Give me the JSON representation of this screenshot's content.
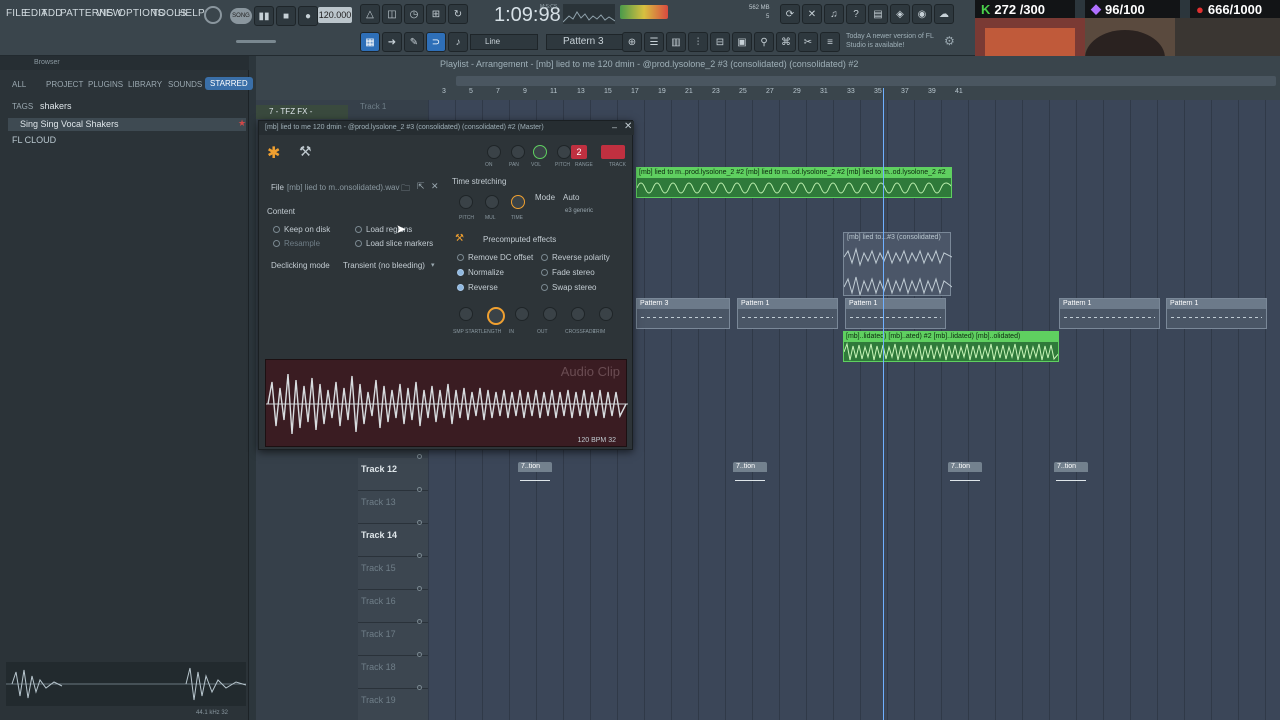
{
  "menu": [
    "FILE",
    "EDIT",
    "ADD",
    "PATTERNS",
    "VIEW",
    "OPTIONS",
    "TOOLS",
    "HELP"
  ],
  "transport": {
    "song_mode": "SONG",
    "tempo": "120.000",
    "time": "1:09:98",
    "time_unit": "M:S:CS",
    "memory": "562 MB",
    "cpu_value": "5",
    "snap": "Line",
    "pattern": "Pattern 3",
    "hint": "Today  A newer version of FL Studio is available!"
  },
  "overlay": {
    "counter1": "272 /300",
    "counter2": "96/100",
    "counter3": "666/1000"
  },
  "browser": {
    "title": "Browser",
    "tabs": [
      "ALL",
      "PROJECT",
      "PLUGINS",
      "LIBRARY",
      "SOUNDS",
      "STARRED"
    ],
    "tags_label": "TAGS",
    "search": "shakers",
    "items": [
      "Sing Sing Vocal Shakers",
      "FL CLOUD"
    ],
    "footer": "44.1 kHz 32"
  },
  "playlist": {
    "title": "Playlist - Arrangement - [mb] lied to me 120 dmin - @prod.lysolone_2 #3 (consolidated) (consolidated) #2",
    "ruler": [
      "3",
      "5",
      "7",
      "9",
      "11",
      "13",
      "15",
      "17",
      "19",
      "21",
      "23",
      "25",
      "27",
      "29",
      "31",
      "33",
      "35",
      "37",
      "39",
      "41"
    ],
    "tracks": [
      {
        "name": "Track 12",
        "on": true
      },
      {
        "name": "Track 13",
        "on": false
      },
      {
        "name": "Track 14",
        "on": true
      },
      {
        "name": "Track 15",
        "on": false
      },
      {
        "name": "Track 16",
        "on": false
      },
      {
        "name": "Track 17",
        "on": false
      },
      {
        "name": "Track 18",
        "on": false
      },
      {
        "name": "Track 19",
        "on": false
      }
    ],
    "track1_label": "Track 1",
    "clip_green_top": "[mb] lied to m..prod.lysolone_2 #2  [mb] lied to m..od.lysolone_2 #2  [mb] lied to m..od.lysolone_2 #2",
    "clip_consolidated": "[mb] lied to...#3 (consolidated)",
    "clip_green_mid": "[mb]..lidated)  [mb]..ated) #2  [mb]..lidated)  [mb]..olidated)",
    "pattern_labels": [
      "Pattern 3",
      "Pattern 1",
      "Pattern 1",
      "Pattern 1",
      "Pattern 1"
    ],
    "auto_label": "7..tion"
  },
  "channel": {
    "tab": "7 - TFZ FX - Transition",
    "title": "[mb] lied to me 120 dmin - @prod.lysolone_2 #3 (consolidated) (consolidated) #2 (Master)",
    "file_label": "File",
    "file_name": "[mb] lied to m..onsolidated).wav",
    "content_label": "Content",
    "keep_on_disk": "Keep on disk",
    "resample": "Resample",
    "load_regions": "Load regions",
    "load_slice_markers": "Load slice markers",
    "declicking_label": "Declicking mode",
    "declicking_value": "Transient (no bleeding)",
    "time_stretching": "Time stretching",
    "mode_label": "Mode",
    "mode_value": "Auto",
    "mode_sub": "e3 generic",
    "precomputed": "Precomputed effects",
    "remove_dc": "Remove DC offset",
    "normalize": "Normalize",
    "reverse": "Reverse",
    "reverse_polarity": "Reverse polarity",
    "fade_stereo": "Fade stereo",
    "swap_stereo": "Swap stereo",
    "audio_clip": "Audio Clip",
    "wave_footer": "120 BPM 32",
    "top_knobs": [
      "ON",
      "PAN",
      "VOL",
      "PITCH",
      "RANGE",
      "TRACK"
    ],
    "track_num": "2",
    "stretch_knobs": [
      "PITCH",
      "MUL",
      "TIME"
    ],
    "bottom_knobs": [
      "SMP START",
      "LENGTH",
      "IN",
      "OUT",
      "CROSSFADE",
      "TRIM"
    ]
  },
  "colors": {
    "accent_green": "#5fd060",
    "accent_orange": "#f0a030",
    "grid": "#3b4658",
    "wave_bg": "#3a1c22"
  }
}
